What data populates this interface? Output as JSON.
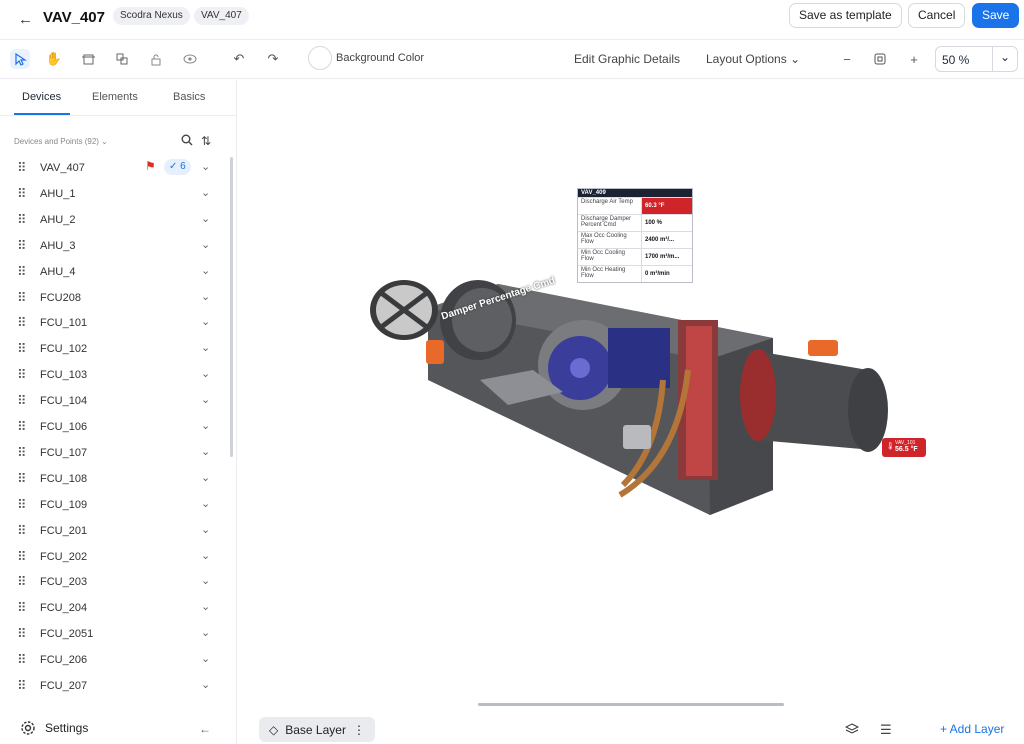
{
  "header": {
    "title": "VAV_407",
    "chips": [
      "Scodra Nexus",
      "VAV_407"
    ],
    "save_template_label": "Save as template",
    "cancel_label": "Cancel",
    "save_label": "Save"
  },
  "toolbar": {
    "background_color_label": "Background Color",
    "edit_graphic_label": "Edit Graphic Details",
    "layout_options_label": "Layout Options",
    "zoom_value": "50 %"
  },
  "sidebar": {
    "tabs": [
      "Devices",
      "Elements",
      "Basics"
    ],
    "section_label": "Devices and Points (92)",
    "devices": [
      {
        "name": "VAV_407",
        "flagged": true,
        "count": "6"
      },
      {
        "name": "AHU_1"
      },
      {
        "name": "AHU_2"
      },
      {
        "name": "AHU_3"
      },
      {
        "name": "AHU_4"
      },
      {
        "name": "FCU208"
      },
      {
        "name": "FCU_101"
      },
      {
        "name": "FCU_102"
      },
      {
        "name": "FCU_103"
      },
      {
        "name": "FCU_104"
      },
      {
        "name": "FCU_106"
      },
      {
        "name": "FCU_107"
      },
      {
        "name": "FCU_108"
      },
      {
        "name": "FCU_109"
      },
      {
        "name": "FCU_201"
      },
      {
        "name": "FCU_202"
      },
      {
        "name": "FCU_203"
      },
      {
        "name": "FCU_204"
      },
      {
        "name": "FCU_2051"
      },
      {
        "name": "FCU_206"
      },
      {
        "name": "FCU_207"
      }
    ],
    "settings_label": "Settings"
  },
  "canvas": {
    "info_table": {
      "title": "VAV_409",
      "rows": [
        {
          "label": "Discharge Air Temp",
          "value": "60.3 °F",
          "alert": true
        },
        {
          "label": "Discharge Damper Percent Cmd",
          "value": "100 %",
          "alert": false
        },
        {
          "label": "Max Occ Cooling Flow",
          "value": "2400 m³/...",
          "alert": false
        },
        {
          "label": "Min Occ Cooling Flow",
          "value": "1700 m³/m...",
          "alert": false
        },
        {
          "label": "Min Occ Heating Flow",
          "value": "0 m³/min",
          "alert": false
        }
      ]
    },
    "damper_label": "Damper Percentage Cmd",
    "temp_badge": {
      "name": "VAV_101",
      "value": "56.5 °F"
    }
  },
  "footer": {
    "layer_label": "Base Layer",
    "add_layer_label": "+ Add Layer"
  },
  "colors": {
    "accent": "#1a73e8",
    "alert": "#d0242b",
    "header_dark": "#1b2233"
  }
}
